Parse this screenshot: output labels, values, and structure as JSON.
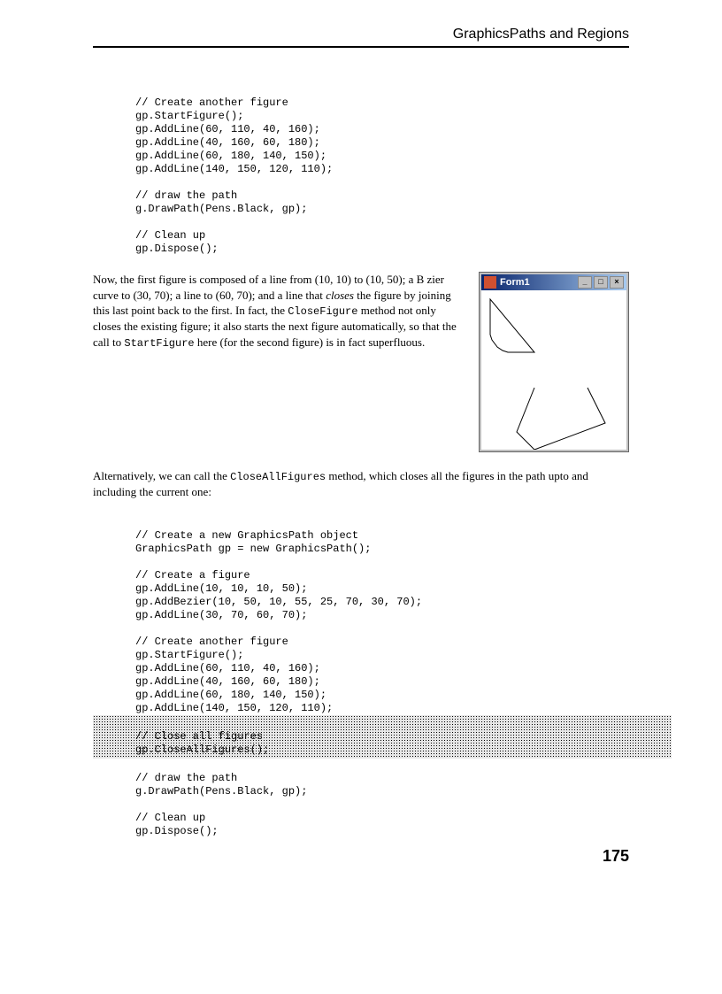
{
  "header": "GraphicsPaths and Regions",
  "page_number": "175",
  "code1": {
    "l1": "// Create another figure",
    "l2": "gp.StartFigure();",
    "l3": "gp.AddLine(60, 110, 40, 160);",
    "l4": "gp.AddLine(40, 160, 60, 180);",
    "l5": "gp.AddLine(60, 180, 140, 150);",
    "l6": "gp.AddLine(140, 150, 120, 110);",
    "l7": "// draw the path",
    "l8": "g.DrawPath(Pens.Black, gp);",
    "l9": "// Clean up",
    "l10": "gp.Dispose();"
  },
  "para1": {
    "t1": "Now, the first figure is composed of a line from (10, 10) to (10, 50); a B  zier curve to (30, 70); a line to (60, 70); and a line that ",
    "t2": "closes",
    "t3": " the figure by joining this last point back to the first. In fact, the ",
    "t4": "CloseFigure",
    "t5": " method not only closes the existing figure; it also starts the next figure automatically, so that the call to ",
    "t6": "StartFigure",
    "t7": " here (for the second figure) is in fact superfluous."
  },
  "window": {
    "title": "Form1",
    "min": "_",
    "max": "□",
    "close": "×"
  },
  "para2": {
    "t1": "Alternatively, we can call the ",
    "t2": "CloseAllFigures",
    "t3": " method, which closes all the figures in the path upto and including the current one:"
  },
  "code2": {
    "l1": "// Create a new GraphicsPath object",
    "l2": "GraphicsPath gp = new GraphicsPath();",
    "l3": "// Create a figure",
    "l4": "gp.AddLine(10, 10, 10, 50);",
    "l5": "gp.AddBezier(10, 50, 10, 55, 25, 70, 30, 70);",
    "l6": "gp.AddLine(30, 70, 60, 70);",
    "l7": "// Create another figure",
    "l8": "gp.StartFigure();",
    "l9": "gp.AddLine(60, 110, 40, 160);",
    "l10": "gp.AddLine(40, 160, 60, 180);",
    "l11": "gp.AddLine(60, 180, 140, 150);",
    "l12": "gp.AddLine(140, 150, 120, 110);",
    "l13": "// Close all figures",
    "l14": "gp.CloseAllFigures();",
    "l15": "// draw the path",
    "l16": "g.DrawPath(Pens.Black, gp);",
    "l17": "// Clean up",
    "l18": "gp.Dispose();"
  }
}
